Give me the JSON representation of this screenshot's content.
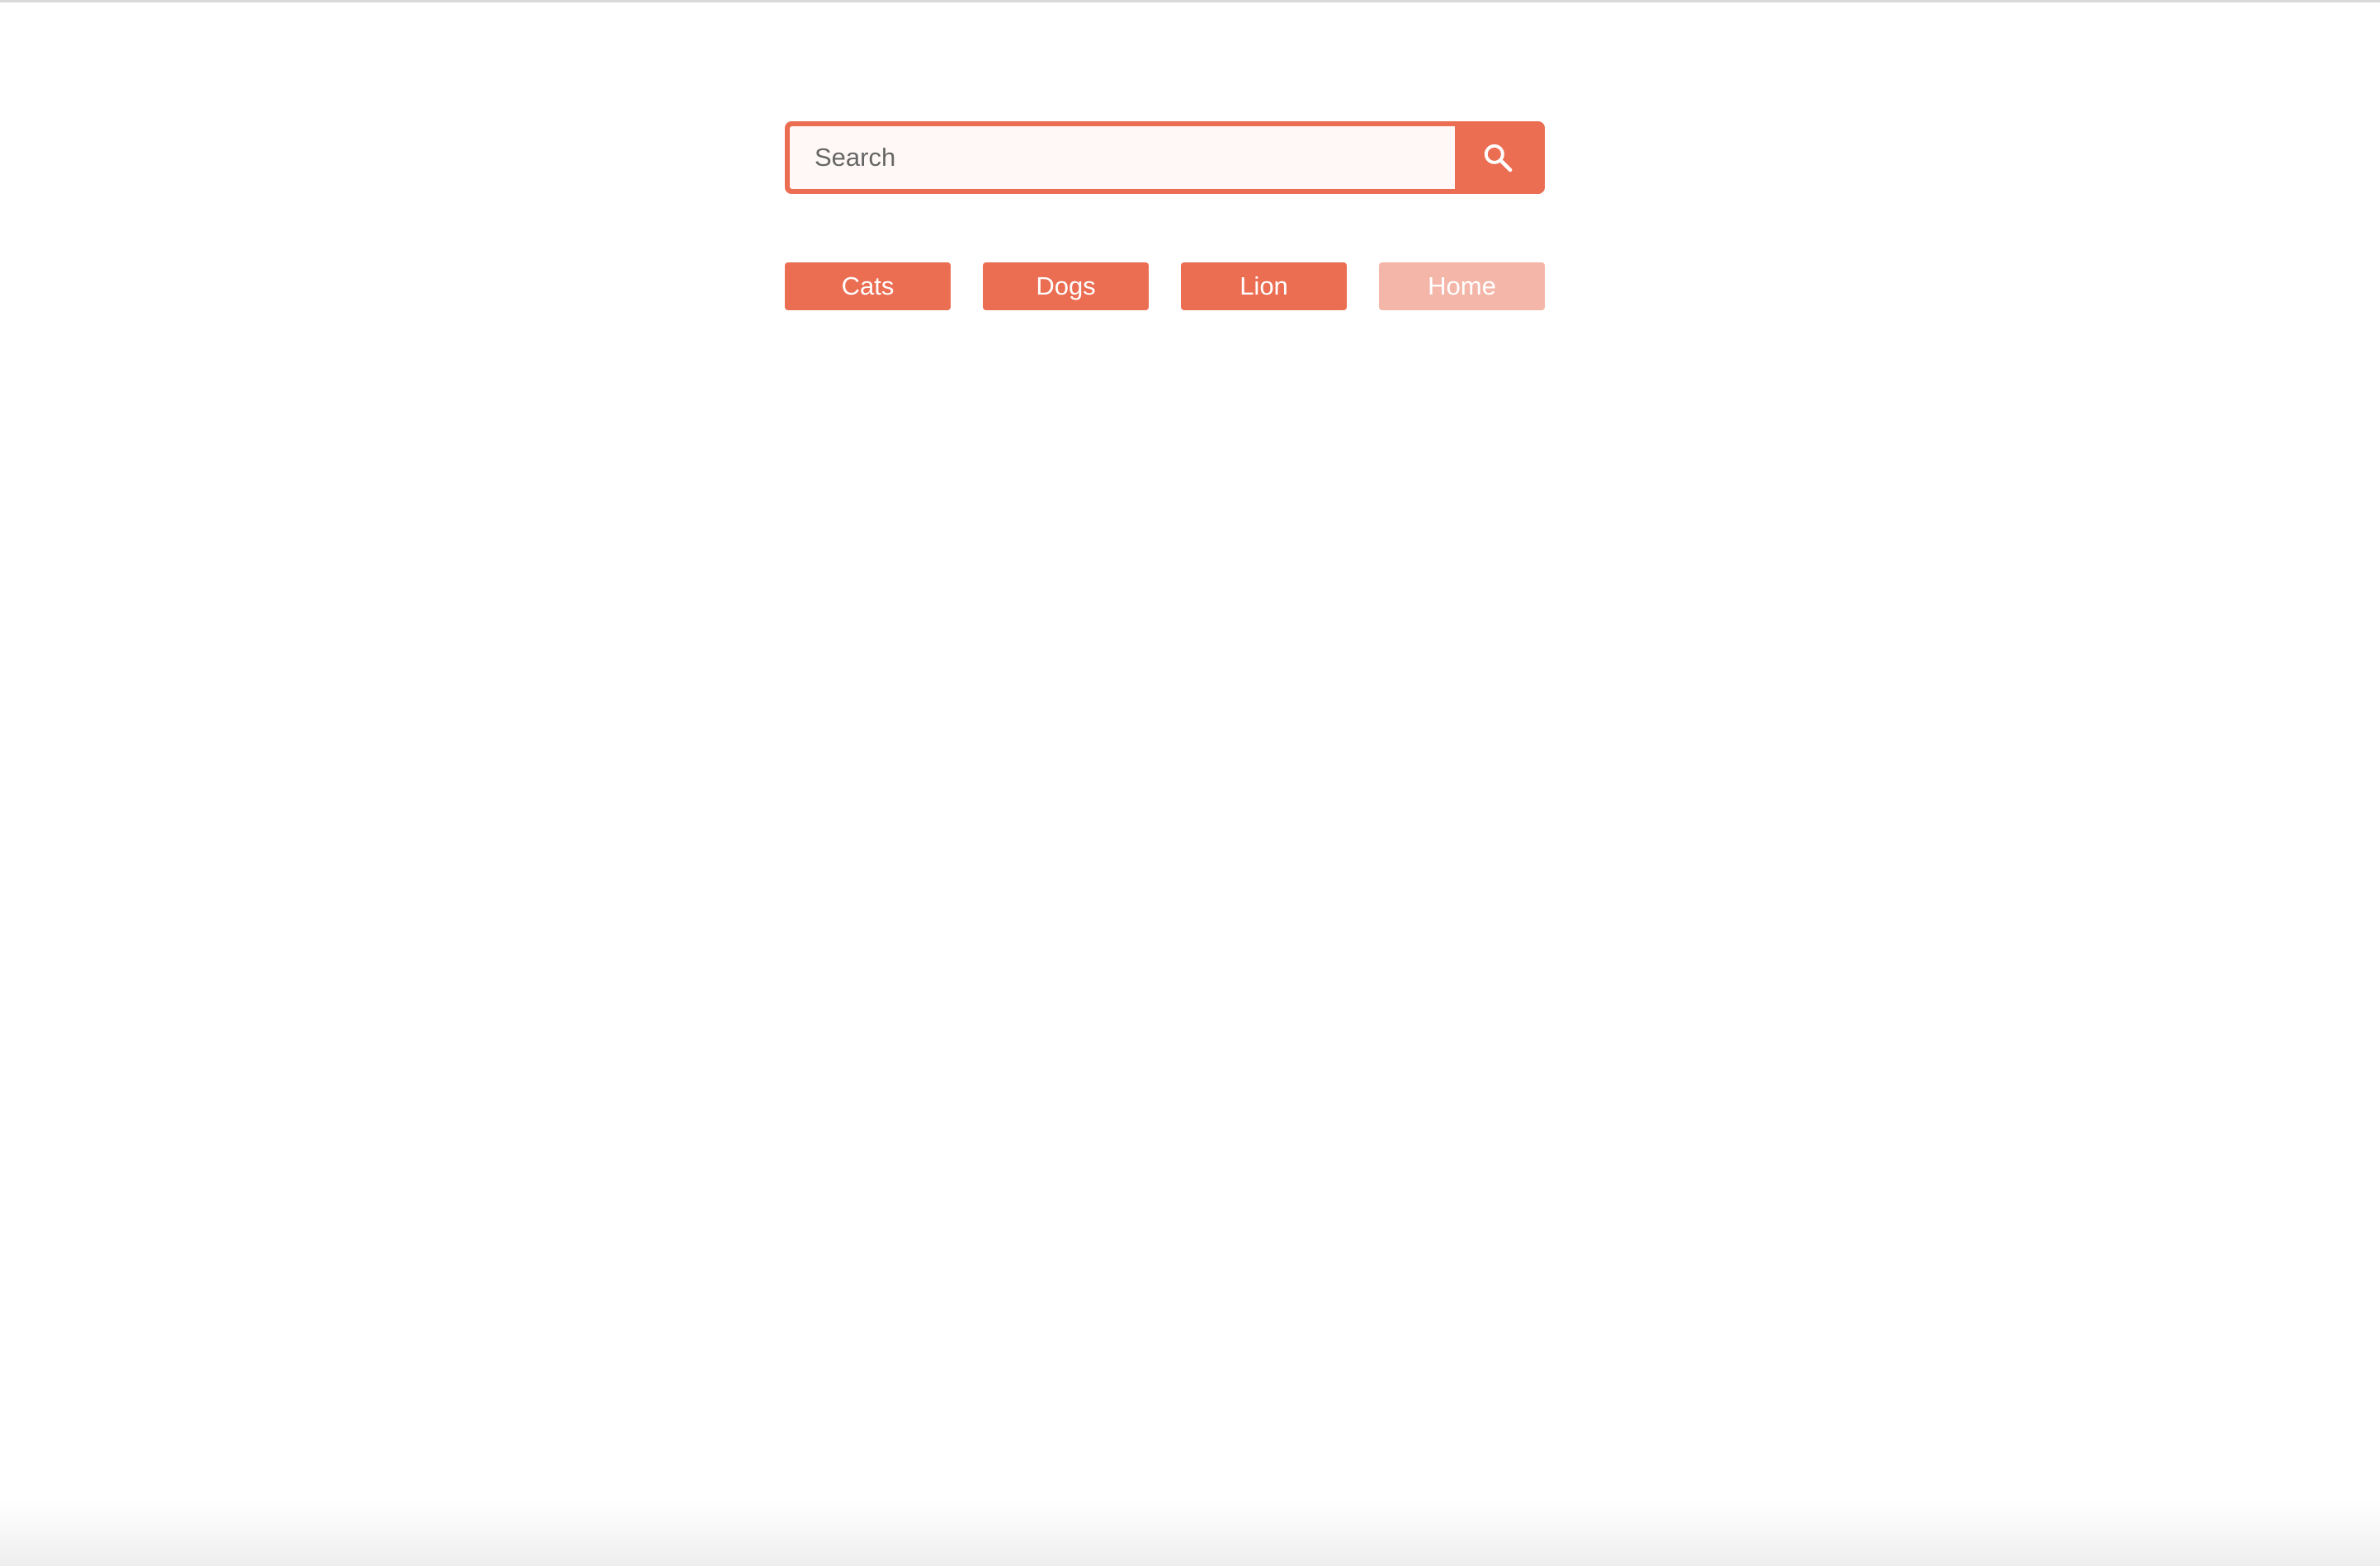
{
  "search": {
    "placeholder": "Search",
    "value": "",
    "button_icon": "search-icon"
  },
  "categories": [
    {
      "label": "Cats",
      "state": "active"
    },
    {
      "label": "Dogs",
      "state": "active"
    },
    {
      "label": "Lion",
      "state": "active"
    },
    {
      "label": "Home",
      "state": "faded"
    }
  ],
  "colors": {
    "accent": "#eb6d52",
    "accent_faded": "#f4b6a8",
    "input_background": "#fff8f6",
    "button_text": "#ffffff"
  }
}
